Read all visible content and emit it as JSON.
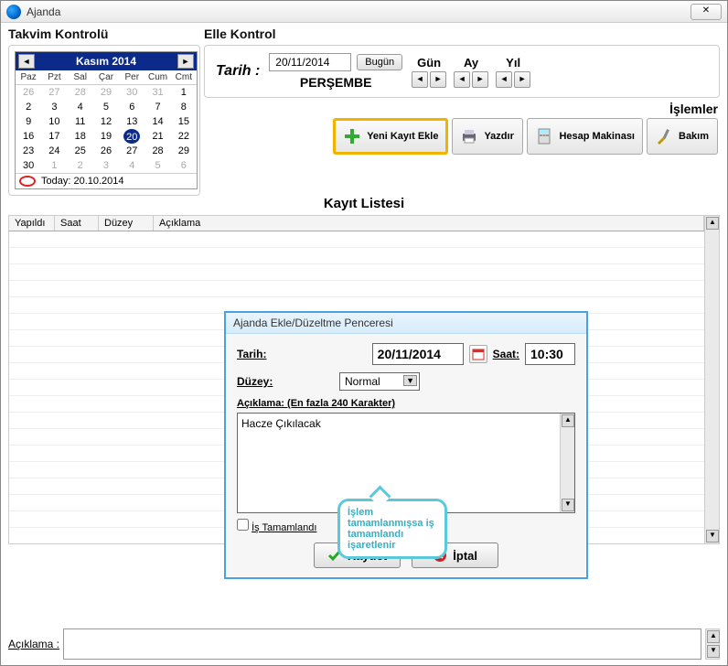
{
  "window": {
    "title": "Ajanda"
  },
  "takvim": {
    "header": "Takvim Kontrolü",
    "month": "Kasım 2014",
    "today_label": "Today: 20.10.2014",
    "day_headers": [
      "Paz",
      "Pzt",
      "Sal",
      "Çar",
      "Per",
      "Cum",
      "Cmt"
    ],
    "cells": [
      {
        "v": "26",
        "dim": true
      },
      {
        "v": "27",
        "dim": true
      },
      {
        "v": "28",
        "dim": true
      },
      {
        "v": "29",
        "dim": true
      },
      {
        "v": "30",
        "dim": true
      },
      {
        "v": "31",
        "dim": true
      },
      {
        "v": "1"
      },
      {
        "v": "2"
      },
      {
        "v": "3"
      },
      {
        "v": "4"
      },
      {
        "v": "5"
      },
      {
        "v": "6"
      },
      {
        "v": "7"
      },
      {
        "v": "8"
      },
      {
        "v": "9"
      },
      {
        "v": "10"
      },
      {
        "v": "11"
      },
      {
        "v": "12"
      },
      {
        "v": "13"
      },
      {
        "v": "14"
      },
      {
        "v": "15"
      },
      {
        "v": "16"
      },
      {
        "v": "17"
      },
      {
        "v": "18"
      },
      {
        "v": "19"
      },
      {
        "v": "20",
        "today": true
      },
      {
        "v": "21"
      },
      {
        "v": "22"
      },
      {
        "v": "23"
      },
      {
        "v": "24"
      },
      {
        "v": "25"
      },
      {
        "v": "26"
      },
      {
        "v": "27"
      },
      {
        "v": "28"
      },
      {
        "v": "29"
      },
      {
        "v": "30"
      },
      {
        "v": "1",
        "dim": true
      },
      {
        "v": "2",
        "dim": true
      },
      {
        "v": "3",
        "dim": true
      },
      {
        "v": "4",
        "dim": true
      },
      {
        "v": "5",
        "dim": true
      },
      {
        "v": "6",
        "dim": true
      }
    ]
  },
  "elle": {
    "header": "Elle Kontrol",
    "tarih_label": "Tarih :",
    "date_value": "20/11/2014",
    "bugun_label": "Bugün",
    "day_name": "PERŞEMBE",
    "steppers": {
      "gun": "Gün",
      "ay": "Ay",
      "yil": "Yıl"
    }
  },
  "ops": {
    "header": "İşlemler",
    "yeni": "Yeni Kayıt Ekle",
    "yazdir": "Yazdır",
    "hesap": "Hesap Makinası",
    "bakim": "Bakım"
  },
  "list": {
    "title": "Kayıt Listesi",
    "cols": {
      "yapildi": "Yapıldı",
      "saat": "Saat",
      "duzey": "Düzey",
      "aciklama": "Açıklama"
    }
  },
  "dialog": {
    "title": "Ajanda Ekle/Düzeltme Penceresi",
    "tarih_label": "Tarih:",
    "tarih_value": "20/11/2014",
    "saat_label": "Saat:",
    "saat_value": "10:30",
    "duzey_label": "Düzey:",
    "duzey_value": "Normal",
    "aciklama_label": "Açıklama: (En fazla 240 Karakter)",
    "aciklama_value": "Hacze Çıkılacak",
    "is_tamamlandi": "İş Tamamlandı",
    "kaydet": "Kaydet",
    "iptal": "İptal",
    "callout": "İşlem tamamlanmışsa iş tamamlandı işaretlenir"
  },
  "footer": {
    "label": "Açıklama :"
  }
}
